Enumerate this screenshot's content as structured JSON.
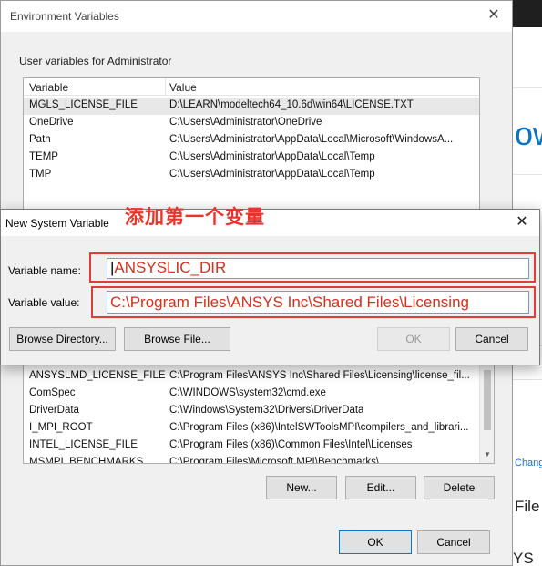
{
  "env_window": {
    "title": "Environment Variables",
    "close_glyph": "✕",
    "user_group_label": "User variables for Administrator",
    "user_columns": [
      "Variable",
      "Value"
    ],
    "user_rows": [
      {
        "variable": "MGLS_LICENSE_FILE",
        "value": "D:\\LEARN\\modeltech64_10.6d\\win64\\LICENSE.TXT"
      },
      {
        "variable": "OneDrive",
        "value": "C:\\Users\\Administrator\\OneDrive"
      },
      {
        "variable": "Path",
        "value": "C:\\Users\\Administrator\\AppData\\Local\\Microsoft\\WindowsA..."
      },
      {
        "variable": "TEMP",
        "value": "C:\\Users\\Administrator\\AppData\\Local\\Temp"
      },
      {
        "variable": "TMP",
        "value": "C:\\Users\\Administrator\\AppData\\Local\\Temp"
      }
    ],
    "system_rows": [
      {
        "variable": "ANSYSLMD_LICENSE_FILE",
        "value": "C:\\Program Files\\ANSYS Inc\\Shared Files\\Licensing\\license_fil..."
      },
      {
        "variable": "ComSpec",
        "value": "C:\\WINDOWS\\system32\\cmd.exe"
      },
      {
        "variable": "DriverData",
        "value": "C:\\Windows\\System32\\Drivers\\DriverData"
      },
      {
        "variable": "I_MPI_ROOT",
        "value": "C:\\Program Files (x86)\\IntelSWToolsMPI\\compilers_and_librari..."
      },
      {
        "variable": "INTEL_LICENSE_FILE",
        "value": "C:\\Program Files (x86)\\Common Files\\Intel\\Licenses"
      },
      {
        "variable": "MSMPI_BENCHMARKS",
        "value": "C:\\Program Files\\Microsoft MPI\\Benchmarks\\"
      }
    ],
    "system_buttons": {
      "new": "New...",
      "edit": "Edit...",
      "delete": "Delete"
    },
    "footer_buttons": {
      "ok": "OK",
      "cancel": "Cancel"
    }
  },
  "annotation": "添加第一个变量",
  "new_var_dialog": {
    "title": "New System Variable",
    "close_glyph": "✕",
    "name_label": "Variable name:",
    "name_value": "ANSYSLIC_DIR",
    "value_label": "Variable value:",
    "value_value": "C:\\Program Files\\ANSYS Inc\\Shared Files\\Licensing",
    "buttons": {
      "browse_directory": "Browse Directory...",
      "browse_file": "Browse File...",
      "ok": "OK",
      "cancel": "Cancel"
    }
  },
  "background_app": {
    "big_text": "ow",
    "link_text": "Chang",
    "fragment_1": "File",
    "fragment_2": "YS I"
  },
  "colors": {
    "annotation_red": "#e8352c",
    "input_text_red": "#d6301f",
    "link_blue": "#1a6fc4"
  }
}
